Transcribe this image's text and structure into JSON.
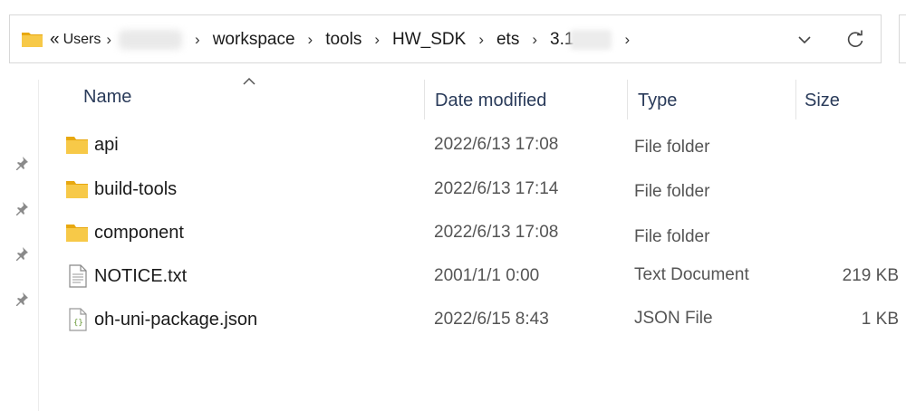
{
  "address_bar": {
    "overflow_label": "«",
    "crumbs": [
      "Users",
      "workspace",
      "tools",
      "HW_SDK",
      "ets",
      "3.1"
    ]
  },
  "columns": {
    "name": "Name",
    "date": "Date modified",
    "type": "Type",
    "size": "Size"
  },
  "files": [
    {
      "name": "api",
      "date": "2022/6/13 17:08",
      "type": "File folder",
      "size": "",
      "icon": "folder-icon"
    },
    {
      "name": "build-tools",
      "date": "2022/6/13 17:14",
      "type": "File folder",
      "size": "",
      "icon": "folder-icon"
    },
    {
      "name": "component",
      "date": "2022/6/13 17:08",
      "type": "File folder",
      "size": "",
      "icon": "folder-icon"
    },
    {
      "name": "NOTICE.txt",
      "date": "2001/1/1 0:00",
      "type": "Text Document",
      "size": "219 KB",
      "icon": "text-file-icon"
    },
    {
      "name": "oh-uni-package.json",
      "date": "2022/6/15 8:43",
      "type": "JSON File",
      "size": "1 KB",
      "icon": "json-file-icon"
    }
  ],
  "colors": {
    "folder": "#f4c542",
    "header_text": "#2a3b5a",
    "border": "#d8d8d8"
  }
}
